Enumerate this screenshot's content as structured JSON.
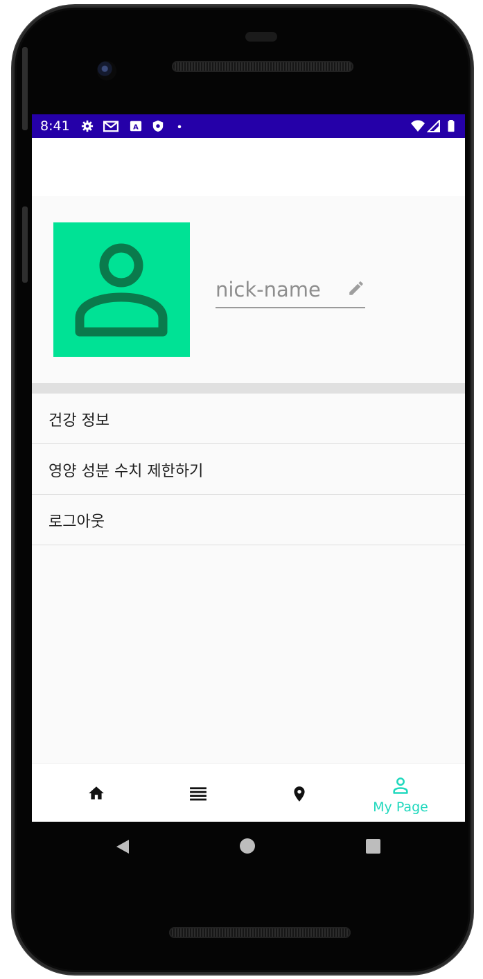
{
  "status_bar": {
    "time": "8:41",
    "left_icons": [
      "gear-icon",
      "gmail-icon",
      "a-badge-icon",
      "shield-icon",
      "dot-icon"
    ],
    "right_icons": [
      "wifi-icon",
      "signal-icon",
      "battery-icon"
    ],
    "background_color": "#2500a8"
  },
  "profile": {
    "avatar_icon": "person-icon",
    "avatar_color": "#00e295",
    "nickname_placeholder": "nick-name",
    "edit_icon": "pencil-icon"
  },
  "menu": {
    "items": [
      {
        "label": "건강 정보"
      },
      {
        "label": "영양 성분 수치 제한하기"
      },
      {
        "label": "로그아웃"
      }
    ]
  },
  "bottom_nav": {
    "active_color": "#1fd8bd",
    "items": [
      {
        "icon": "home-icon",
        "label": "",
        "active": false
      },
      {
        "icon": "list-icon",
        "label": "",
        "active": false
      },
      {
        "icon": "location-pin-icon",
        "label": "",
        "active": false
      },
      {
        "icon": "person-outline-icon",
        "label": "My Page",
        "active": true
      }
    ]
  },
  "system_nav": {
    "icons": [
      "back-icon",
      "home-circle-icon",
      "recents-icon"
    ]
  }
}
